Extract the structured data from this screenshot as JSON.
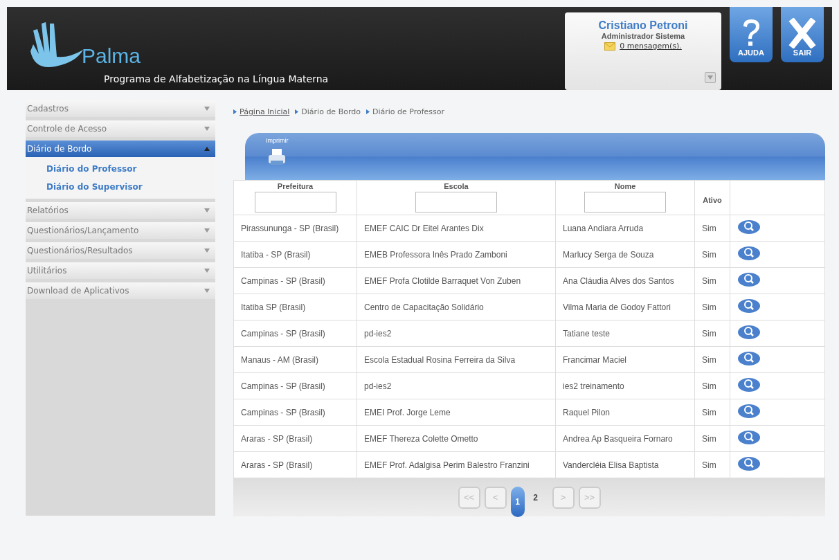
{
  "header": {
    "logo_text": "Palma",
    "subtitle": "Programa de Alfabetização na Língua Materna",
    "user": {
      "name": "Cristiano Petroni",
      "role": "Administrador Sistema",
      "messages": "0 mensagem(s)."
    },
    "buttons": [
      {
        "kind": "help",
        "label": "AJUDA"
      },
      {
        "kind": "exit",
        "label": "SAIR"
      }
    ]
  },
  "sidebar": {
    "items": [
      {
        "label": "Cadastros",
        "expanded": false
      },
      {
        "label": "Controle de Acesso",
        "expanded": false
      },
      {
        "label": "Diário de Bordo",
        "expanded": true,
        "children": [
          {
            "label": "Diário do Professor"
          },
          {
            "label": "Diário do Supervisor"
          }
        ]
      },
      {
        "label": "Relatórios",
        "expanded": false
      },
      {
        "label": "Questionários/Lançamento",
        "expanded": false
      },
      {
        "label": "Questionários/Resultados",
        "expanded": false
      },
      {
        "label": "Utilitários",
        "expanded": false
      },
      {
        "label": "Download de Aplicativos",
        "expanded": false
      }
    ]
  },
  "breadcrumb": [
    {
      "label": "Página Inicial",
      "link": true
    },
    {
      "label": "Diário de Bordo",
      "link": false
    },
    {
      "label": "Diário de Professor",
      "link": false
    }
  ],
  "toolbar": {
    "print_label": "Imprimir"
  },
  "table": {
    "columns": [
      {
        "label": "Prefeitura",
        "filter": true
      },
      {
        "label": "Escola",
        "filter": true
      },
      {
        "label": "Nome",
        "filter": true
      },
      {
        "label": "Ativo",
        "filter": false
      }
    ],
    "rows": [
      [
        "Pirassununga - SP (Brasil)",
        "EMEF CAIC Dr Eitel Arantes Dix",
        "Luana Andiara Arruda",
        "Sim"
      ],
      [
        "Itatiba - SP (Brasil)",
        "EMEB Professora Inês Prado Zamboni",
        "Marlucy Serga de Souza",
        "Sim"
      ],
      [
        "Campinas - SP (Brasil)",
        "EMEF Profa Clotilde Barraquet Von Zuben",
        "Ana Cláudia Alves dos Santos",
        "Sim"
      ],
      [
        "Itatiba SP (Brasil)",
        "Centro de Capacitação Solidário",
        "Vilma Maria de Godoy Fattori",
        "Sim"
      ],
      [
        "Campinas - SP (Brasil)",
        "pd-ies2",
        "Tatiane teste",
        "Sim"
      ],
      [
        "Manaus - AM (Brasil)",
        "Escola Estadual Rosina Ferreira da Silva",
        "Francimar Maciel",
        "Sim"
      ],
      [
        "Campinas - SP (Brasil)",
        "pd-ies2",
        "ies2 treinamento",
        "Sim"
      ],
      [
        "Campinas - SP (Brasil)",
        "EMEI Prof. Jorge Leme",
        "Raquel Pilon",
        "Sim"
      ],
      [
        "Araras - SP (Brasil)",
        "EMEF Thereza Colette Ometto",
        "Andrea Ap Basqueira Fornaro",
        "Sim"
      ],
      [
        "Araras - SP (Brasil)",
        "EMEF Prof. Adalgisa Perim Balestro Franzini",
        "Vandercléia Elisa Baptista",
        "Sim"
      ]
    ]
  },
  "pager": [
    {
      "label": "<<",
      "kind": "nav"
    },
    {
      "label": "<",
      "kind": "nav"
    },
    {
      "label": "1",
      "kind": "page",
      "selected": true
    },
    {
      "label": "2",
      "kind": "page",
      "selected": false
    },
    {
      "label": ">",
      "kind": "nav"
    },
    {
      "label": ">>",
      "kind": "nav"
    }
  ]
}
